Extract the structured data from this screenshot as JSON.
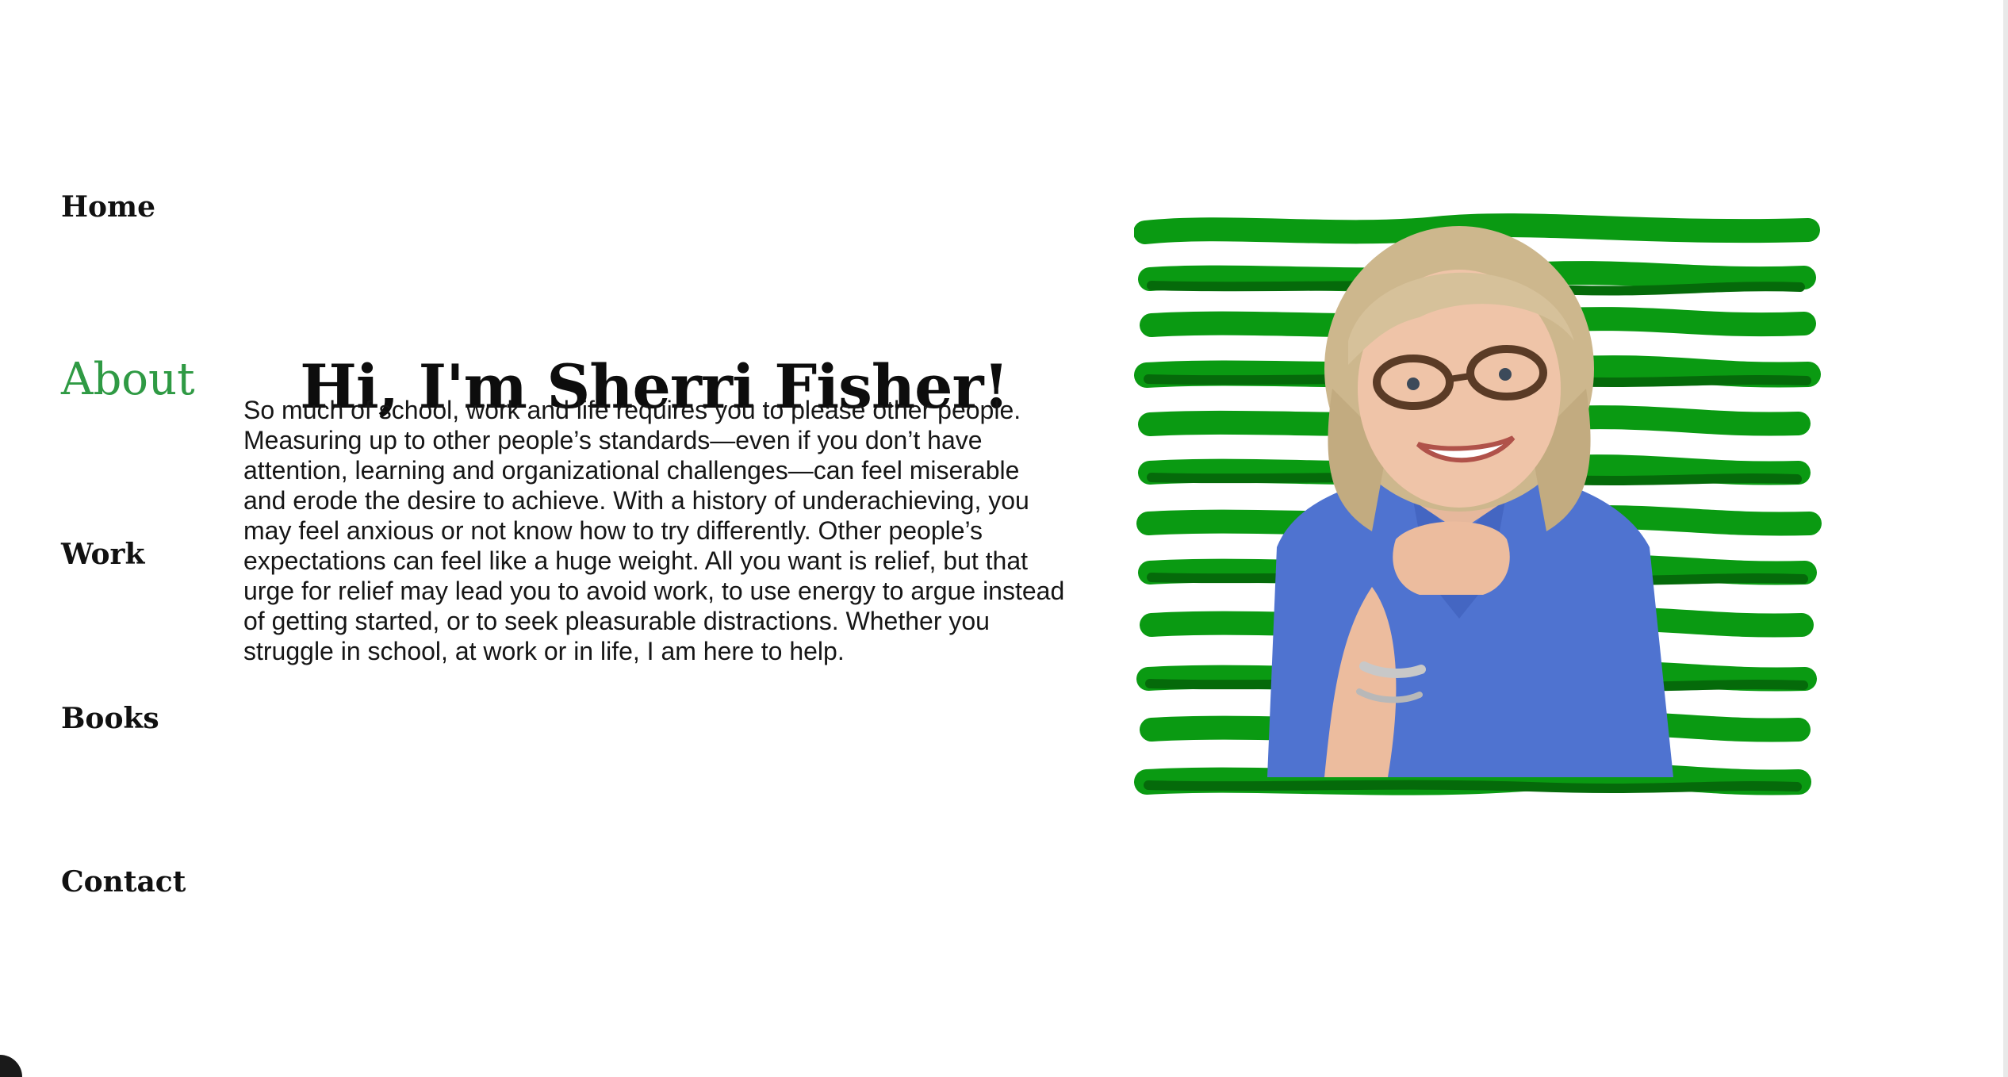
{
  "nav": {
    "home": "Home",
    "about": "About",
    "work": "Work",
    "books": "Books",
    "contact": "Contact",
    "active": "About"
  },
  "hero": {
    "title": "Hi, I'm Sherri Fisher!",
    "body": "So much of school, work and life requires you to please other people. Measuring up to other people’s standards—even if you don’t have attention, learning and organizational challenges—can feel miserable and erode the desire to achieve. With a history of underachieving, you may feel anxious or not know how to try differently. Other people’s expectations can feel like a huge weight. All you want is relief, but that urge for relief may lead you to avoid work, to use energy to argue instead of getting started, or to seek pleasurable distractions. Whether you struggle in school, at work or in life, I am here to help."
  },
  "colors": {
    "accent": "#2f9a44",
    "stripe": "#0a9a12",
    "stripe_dark": "#056a0a",
    "shirt": "#4f73d0",
    "hair": "#cdb78d"
  },
  "portrait": {
    "icon": "person-photo-icon",
    "background": "green-brush-stripes"
  }
}
